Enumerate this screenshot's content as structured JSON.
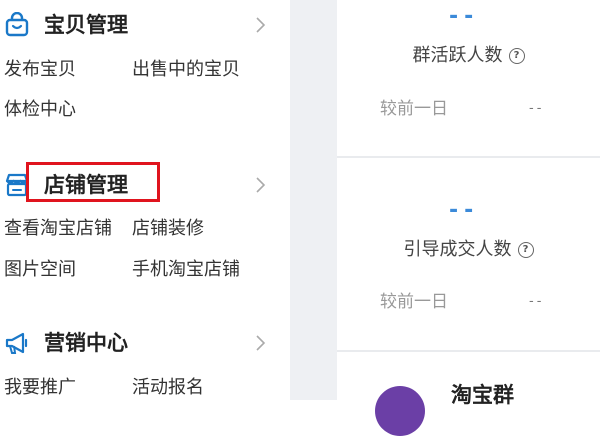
{
  "sidebar": {
    "sections": [
      {
        "icon": "shopping-bag-icon",
        "title": "宝贝管理",
        "items": [
          "发布宝贝",
          "出售中的宝贝",
          "体检中心"
        ]
      },
      {
        "icon": "storefront-icon",
        "title": "店铺管理",
        "items": [
          "查看淘宝店铺",
          "店铺装修",
          "图片空间",
          "手机淘宝店铺"
        ]
      },
      {
        "icon": "megaphone-icon",
        "title": "营销中心",
        "items": [
          "我要推广",
          "活动报名"
        ]
      }
    ]
  },
  "stats": {
    "cards": [
      {
        "value": "--",
        "label": "群活跃人数",
        "compare_label": "较前一日",
        "compare_value": "--"
      },
      {
        "value": "--",
        "label": "引导成交人数",
        "compare_label": "较前一日",
        "compare_value": "--"
      }
    ],
    "group_name": "淘宝群"
  },
  "colors": {
    "accent": "#3b8ad9",
    "highlight": "#e0141e",
    "icon": "#1a78c8",
    "avatar": "#6b3fa6"
  }
}
